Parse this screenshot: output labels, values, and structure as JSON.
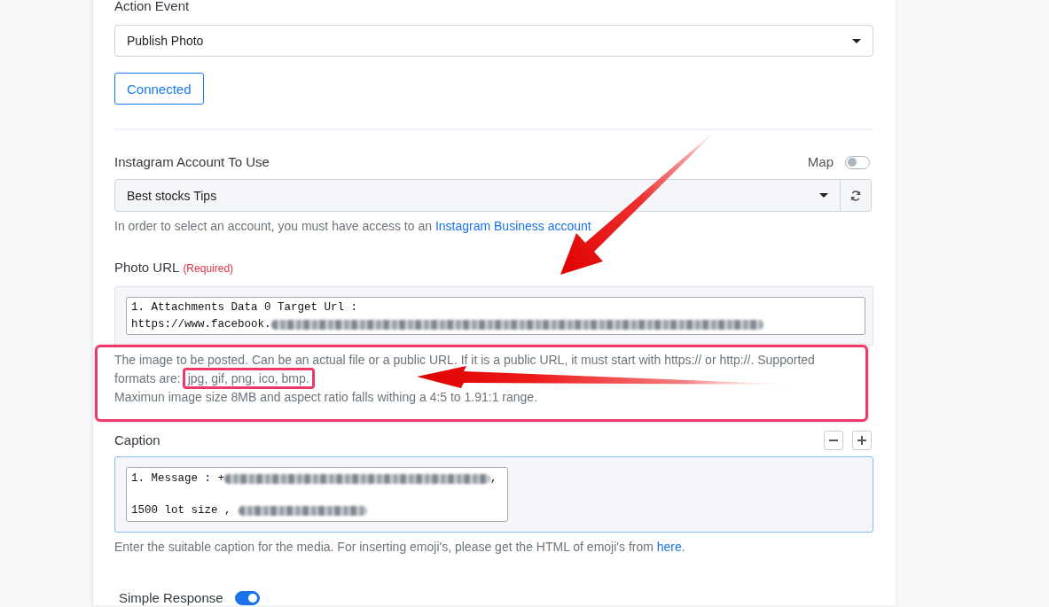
{
  "action_event": {
    "label": "Action Event",
    "value": "Publish Photo"
  },
  "connection_button": {
    "label": "Connected"
  },
  "instagram_account": {
    "label": "Instagram Account To Use",
    "map": {
      "label": "Map",
      "on": false
    },
    "value": "Best stocks Tips",
    "help": {
      "text": "In order to select an account, you must have access to an",
      "link": "Instagram Business account"
    }
  },
  "photo_url": {
    "label": "Photo URL",
    "required": "(Required)",
    "lines": [
      {
        "text": "1. Attachments Data 0 Target Url :",
        "redacted": false
      },
      {
        "text": "https://www.facebook.",
        "redacted": true
      }
    ],
    "help": {
      "highlighted": true,
      "segments": [
        {
          "text": "The image to be posted. Can be an actual file or a public URL. If it is a public URL, it must start with https:// or http://. Supported formats are:",
          "highlighted": false
        },
        {
          "text": "jpg, gif, png, ico, bmp.",
          "highlighted": true
        }
      ],
      "note": "Maximun image size 8MB and aspect ratio falls withing a 4:5 to 1.91:1 range."
    }
  },
  "caption": {
    "label": "Caption",
    "focused": true,
    "lines": [
      {
        "text": "1. Message : +",
        "redacted": true,
        "after": ","
      },
      {
        "text": "1500 lot size ,",
        "redacted": true
      }
    ],
    "help": {
      "text": "Enter the suitable caption for the media. For inserting emoji's, please get the HTML of emoji's from",
      "link": "here",
      "end": "."
    }
  },
  "simple_response": {
    "label": "Simple Response",
    "on": true
  }
}
